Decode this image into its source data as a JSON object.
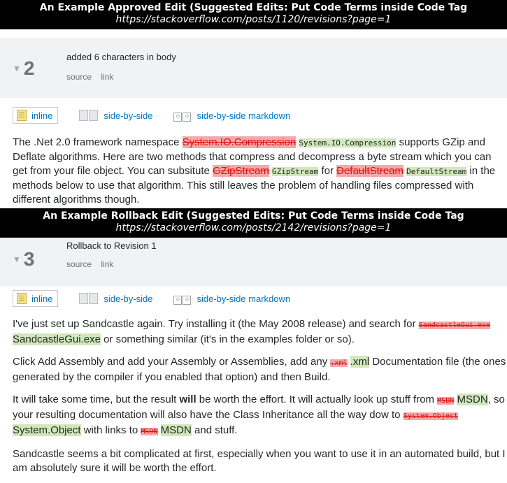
{
  "sections": [
    {
      "banner_title": "An Example Approved Edit (Suggested Edits: Put Code Terms inside Code Tag",
      "banner_url": "https://stackoverflow.com/posts/1120/revisions?page=1",
      "revision_number": "2",
      "summary": "added 6 characters in body",
      "links": [
        "source",
        "link"
      ],
      "tabs": [
        "inline",
        "side-by-side",
        "side-by-side markdown"
      ]
    },
    {
      "banner_title": "An Example Rollback Edit (Suggested Edits: Put Code Terms inside Code Tag",
      "banner_url": "https://stackoverflow.com/posts/2142/revisions?page=1",
      "revision_number": "3",
      "summary": "Rollback to Revision 1",
      "links": [
        "source",
        "link"
      ],
      "tabs": [
        "inline",
        "side-by-side",
        "side-by-side markdown"
      ]
    }
  ],
  "body1": {
    "t1": "The .Net 2.0 framework namespace ",
    "d1": "System.IO.Compression",
    "i1": "System.IO.Compression",
    "t2": " supports GZip and Deflate algorithms. Here are two methods that compress and decompress a byte stream which you can get from your file object. You can subsitute ",
    "d2": "GZipStream",
    "i2": "GZipStream",
    "t3": " for ",
    "d3": "DefaultStream",
    "i3": "DefaultStream",
    "t4": " in the methods below to use that algorithm. This still leaves the problem of handling files compressed with different algorithms though."
  },
  "body2": {
    "p1a": "I've just set up Sandcastle again. Try installing it (the May 2008 release) and search for ",
    "p1d": "SandcastleGui.exe",
    "p1i": "SandcastleGui.exe",
    "p1b": " or something similar (it's in the examples folder or so).",
    "p2a": "Click Add Assembly and add your Assembly or Assemblies, add any ",
    "p2d": ".xml",
    "p2i": ".xml",
    "p2b": " Documentation file (the ones generated by the compiler if you enabled that option) and then Build.",
    "p3a": "It will take some time, but the result ",
    "p3bold": "will",
    "p3b": " be worth the effort. It will actually look up stuff from ",
    "p3d1": "MSDN",
    "p3i1": "MSDN",
    "p3c": ", so your resulting documentation will also have the Class Inheritance all the way dow to ",
    "p3d2": "System.Object",
    "p3i2": "System.Object",
    "p3e": " with links to ",
    "p3d3": "MSDN",
    "p3i3": "MSDN",
    "p3f": " and stuff.",
    "p4": "Sandcastle seems a bit complicated at first, especially when you want to use it in an automated build, but I am absolutely sure it will be worth the effort."
  }
}
